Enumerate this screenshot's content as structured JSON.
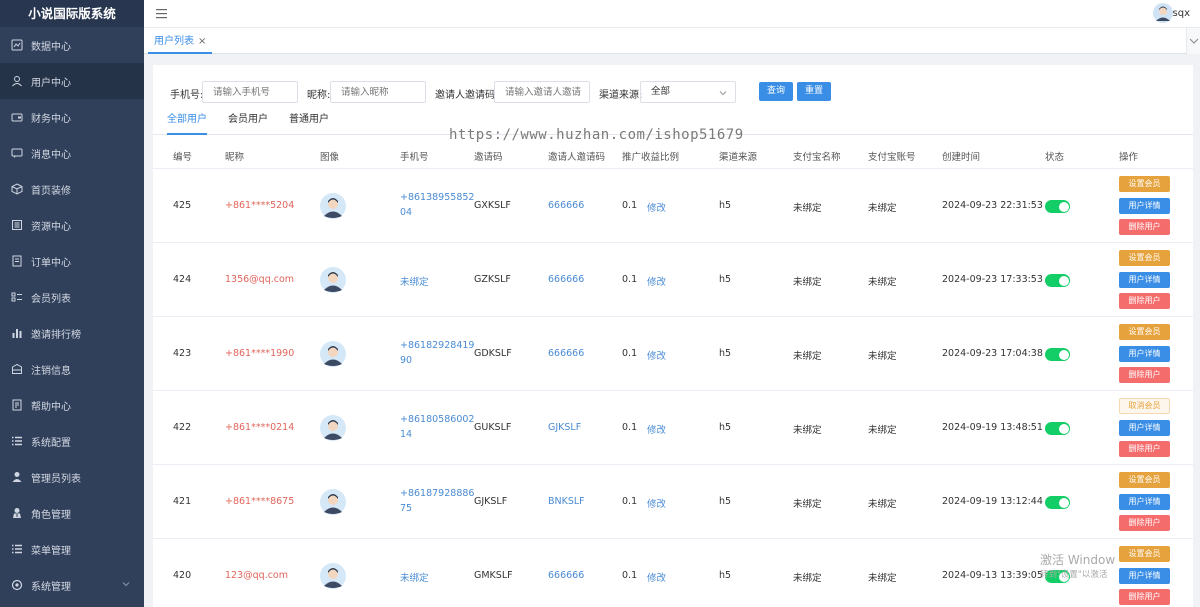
{
  "app": {
    "title": "小说国际版系统"
  },
  "sidebar": {
    "items": [
      {
        "label": "数据中心",
        "icon": "dashboard-icon"
      },
      {
        "label": "用户中心",
        "icon": "user-icon"
      },
      {
        "label": "财务中心",
        "icon": "wallet-icon"
      },
      {
        "label": "消息中心",
        "icon": "message-icon"
      },
      {
        "label": "首页装修",
        "icon": "cube-icon"
      },
      {
        "label": "资源中心",
        "icon": "resource-icon"
      },
      {
        "label": "订单中心",
        "icon": "order-icon"
      },
      {
        "label": "会员列表",
        "icon": "member-list-icon"
      },
      {
        "label": "邀请排行榜",
        "icon": "ranking-icon"
      },
      {
        "label": "注销信息",
        "icon": "logout-info-icon"
      },
      {
        "label": "帮助中心",
        "icon": "help-icon"
      },
      {
        "label": "系统配置",
        "icon": "config-list-icon"
      },
      {
        "label": "管理员列表",
        "icon": "admin-icon"
      },
      {
        "label": "角色管理",
        "icon": "role-icon"
      },
      {
        "label": "菜单管理",
        "icon": "menu-list-icon"
      },
      {
        "label": "系统管理",
        "icon": "settings-icon"
      }
    ]
  },
  "header": {
    "username": "sqx"
  },
  "tabs": {
    "active_label": "用户列表",
    "close": "×"
  },
  "filters": {
    "phone_label": "手机号:",
    "phone_placeholder": "请输入手机号",
    "nickname_label": "昵称:",
    "nickname_placeholder": "请输入昵称",
    "invite_label": "邀请人邀请码:",
    "invite_placeholder": "请输入邀请人邀请",
    "channel_label": "渠道来源:",
    "channel_value": "全部",
    "query_button": "查询",
    "reset_button": "重置"
  },
  "subtabs": [
    "全部用户",
    "会员用户",
    "普通用户"
  ],
  "table": {
    "columns": [
      "编号",
      "昵称",
      "图像",
      "手机号",
      "邀请码",
      "邀请人邀请码",
      "推广收益比例",
      "渠道来源",
      "支付宝名称",
      "支付宝账号",
      "创建时间",
      "状态",
      "操作"
    ],
    "modify_label": "修改",
    "rows": [
      {
        "id": "425",
        "nickname": "+861****5204",
        "phone_l1": "+86138955852",
        "phone_l2": "04",
        "invite_code": "GXKSLF",
        "inviter_code": "666666",
        "ratio": "0.1",
        "channel": "h5",
        "alipay_name": "未绑定",
        "alipay_account": "未绑定",
        "created": "2024-09-23 22:31:53",
        "member_action": "设置会员",
        "member_light": false
      },
      {
        "id": "424",
        "nickname": "1356@qq.com",
        "phone_l1": "未绑定",
        "phone_l2": "",
        "invite_code": "GZKSLF",
        "inviter_code": "666666",
        "ratio": "0.1",
        "channel": "h5",
        "alipay_name": "未绑定",
        "alipay_account": "未绑定",
        "created": "2024-09-23 17:33:53",
        "member_action": "设置会员",
        "member_light": false
      },
      {
        "id": "423",
        "nickname": "+861****1990",
        "phone_l1": "+86182928419",
        "phone_l2": "90",
        "invite_code": "GDKSLF",
        "inviter_code": "666666",
        "ratio": "0.1",
        "channel": "h5",
        "alipay_name": "未绑定",
        "alipay_account": "未绑定",
        "created": "2024-09-23 17:04:38",
        "member_action": "设置会员",
        "member_light": false
      },
      {
        "id": "422",
        "nickname": "+861****0214",
        "phone_l1": "+86180586002",
        "phone_l2": "14",
        "invite_code": "GUKSLF",
        "inviter_code": "GJKSLF",
        "ratio": "0.1",
        "channel": "h5",
        "alipay_name": "未绑定",
        "alipay_account": "未绑定",
        "created": "2024-09-19 13:48:51",
        "member_action": "取消会员",
        "member_light": true
      },
      {
        "id": "421",
        "nickname": "+861****8675",
        "phone_l1": "+86187928886",
        "phone_l2": "75",
        "invite_code": "GJKSLF",
        "inviter_code": "BNKSLF",
        "ratio": "0.1",
        "channel": "h5",
        "alipay_name": "未绑定",
        "alipay_account": "未绑定",
        "created": "2024-09-19 13:12:44",
        "member_action": "设置会员",
        "member_light": false
      },
      {
        "id": "420",
        "nickname": "123@qq.com",
        "phone_l1": "未绑定",
        "phone_l2": "",
        "invite_code": "GMKSLF",
        "inviter_code": "666666",
        "ratio": "0.1",
        "channel": "h5",
        "alipay_name": "未绑定",
        "alipay_account": "未绑定",
        "created": "2024-09-13 13:39:05",
        "member_action": "设置会员",
        "member_light": false
      }
    ],
    "detail_label": "用户详情",
    "delete_label": "删除用户"
  },
  "watermark": "https://www.huzhan.com/ishop51679",
  "windows_activation": {
    "line1": "激活 Window",
    "line2": "转到\"设置\"以激活"
  },
  "colors": {
    "sidebar_bg": "#30405a",
    "accent": "#3a8ee6",
    "switch_on": "#13ce66",
    "warning": "#e6a23c",
    "danger": "#f56c6c",
    "nickname": "#e0665c"
  }
}
